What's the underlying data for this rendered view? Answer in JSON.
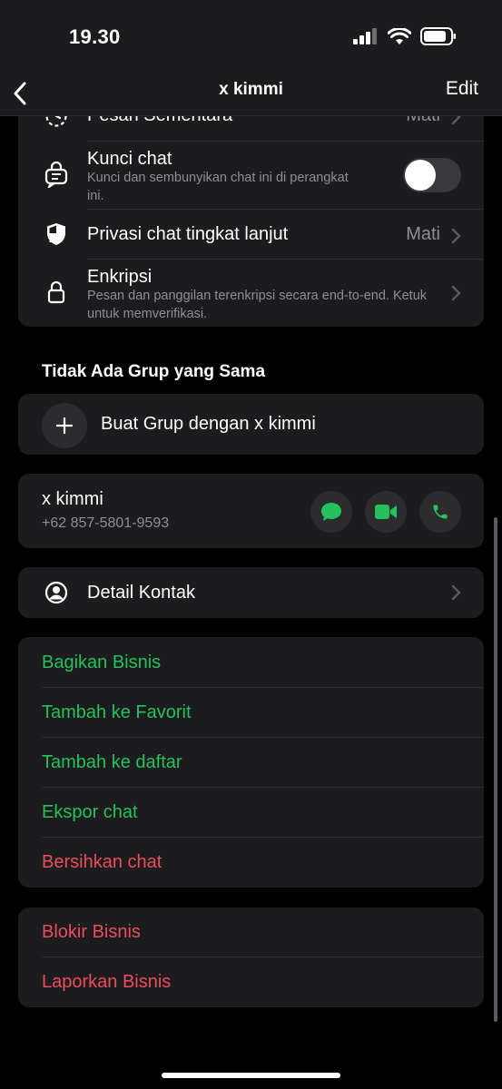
{
  "status": {
    "time": "19.30"
  },
  "nav": {
    "title": "x kimmi",
    "edit_label": "Edit"
  },
  "settings": {
    "pesan_sementara": {
      "title": "Pesan Sementara",
      "value": "Mati"
    },
    "kunci_chat": {
      "title": "Kunci chat",
      "subtitle": "Kunci dan sembunyikan chat ini di perangkat ini.",
      "enabled": false
    },
    "privasi": {
      "title": "Privasi chat tingkat lanjut",
      "value": "Mati"
    },
    "enkripsi": {
      "title": "Enkripsi",
      "subtitle": "Pesan dan panggilan terenkripsi secara end-to-end. Ketuk untuk memverifikasi."
    }
  },
  "groups": {
    "heading": "Tidak Ada Grup yang Sama",
    "create_label": "Buat Grup dengan x kimmi"
  },
  "contact": {
    "name": "x kimmi",
    "phone": "+62 857-5801-9593",
    "actions": [
      "message-icon",
      "video-call-icon",
      "phone-icon"
    ]
  },
  "detail": {
    "label": "Detail Kontak"
  },
  "actions": {
    "bagikan": "Bagikan Bisnis",
    "favorit": "Tambah ke Favorit",
    "daftar": "Tambah ke daftar",
    "ekspor": "Ekspor chat",
    "bersihkan": "Bersihkan chat"
  },
  "danger": {
    "blokir": "Blokir Bisnis",
    "laporkan": "Laporkan Bisnis"
  },
  "colors": {
    "accent_green": "#25c15a",
    "danger_red": "#eb4d5c",
    "card_bg": "#1c1c1e"
  }
}
